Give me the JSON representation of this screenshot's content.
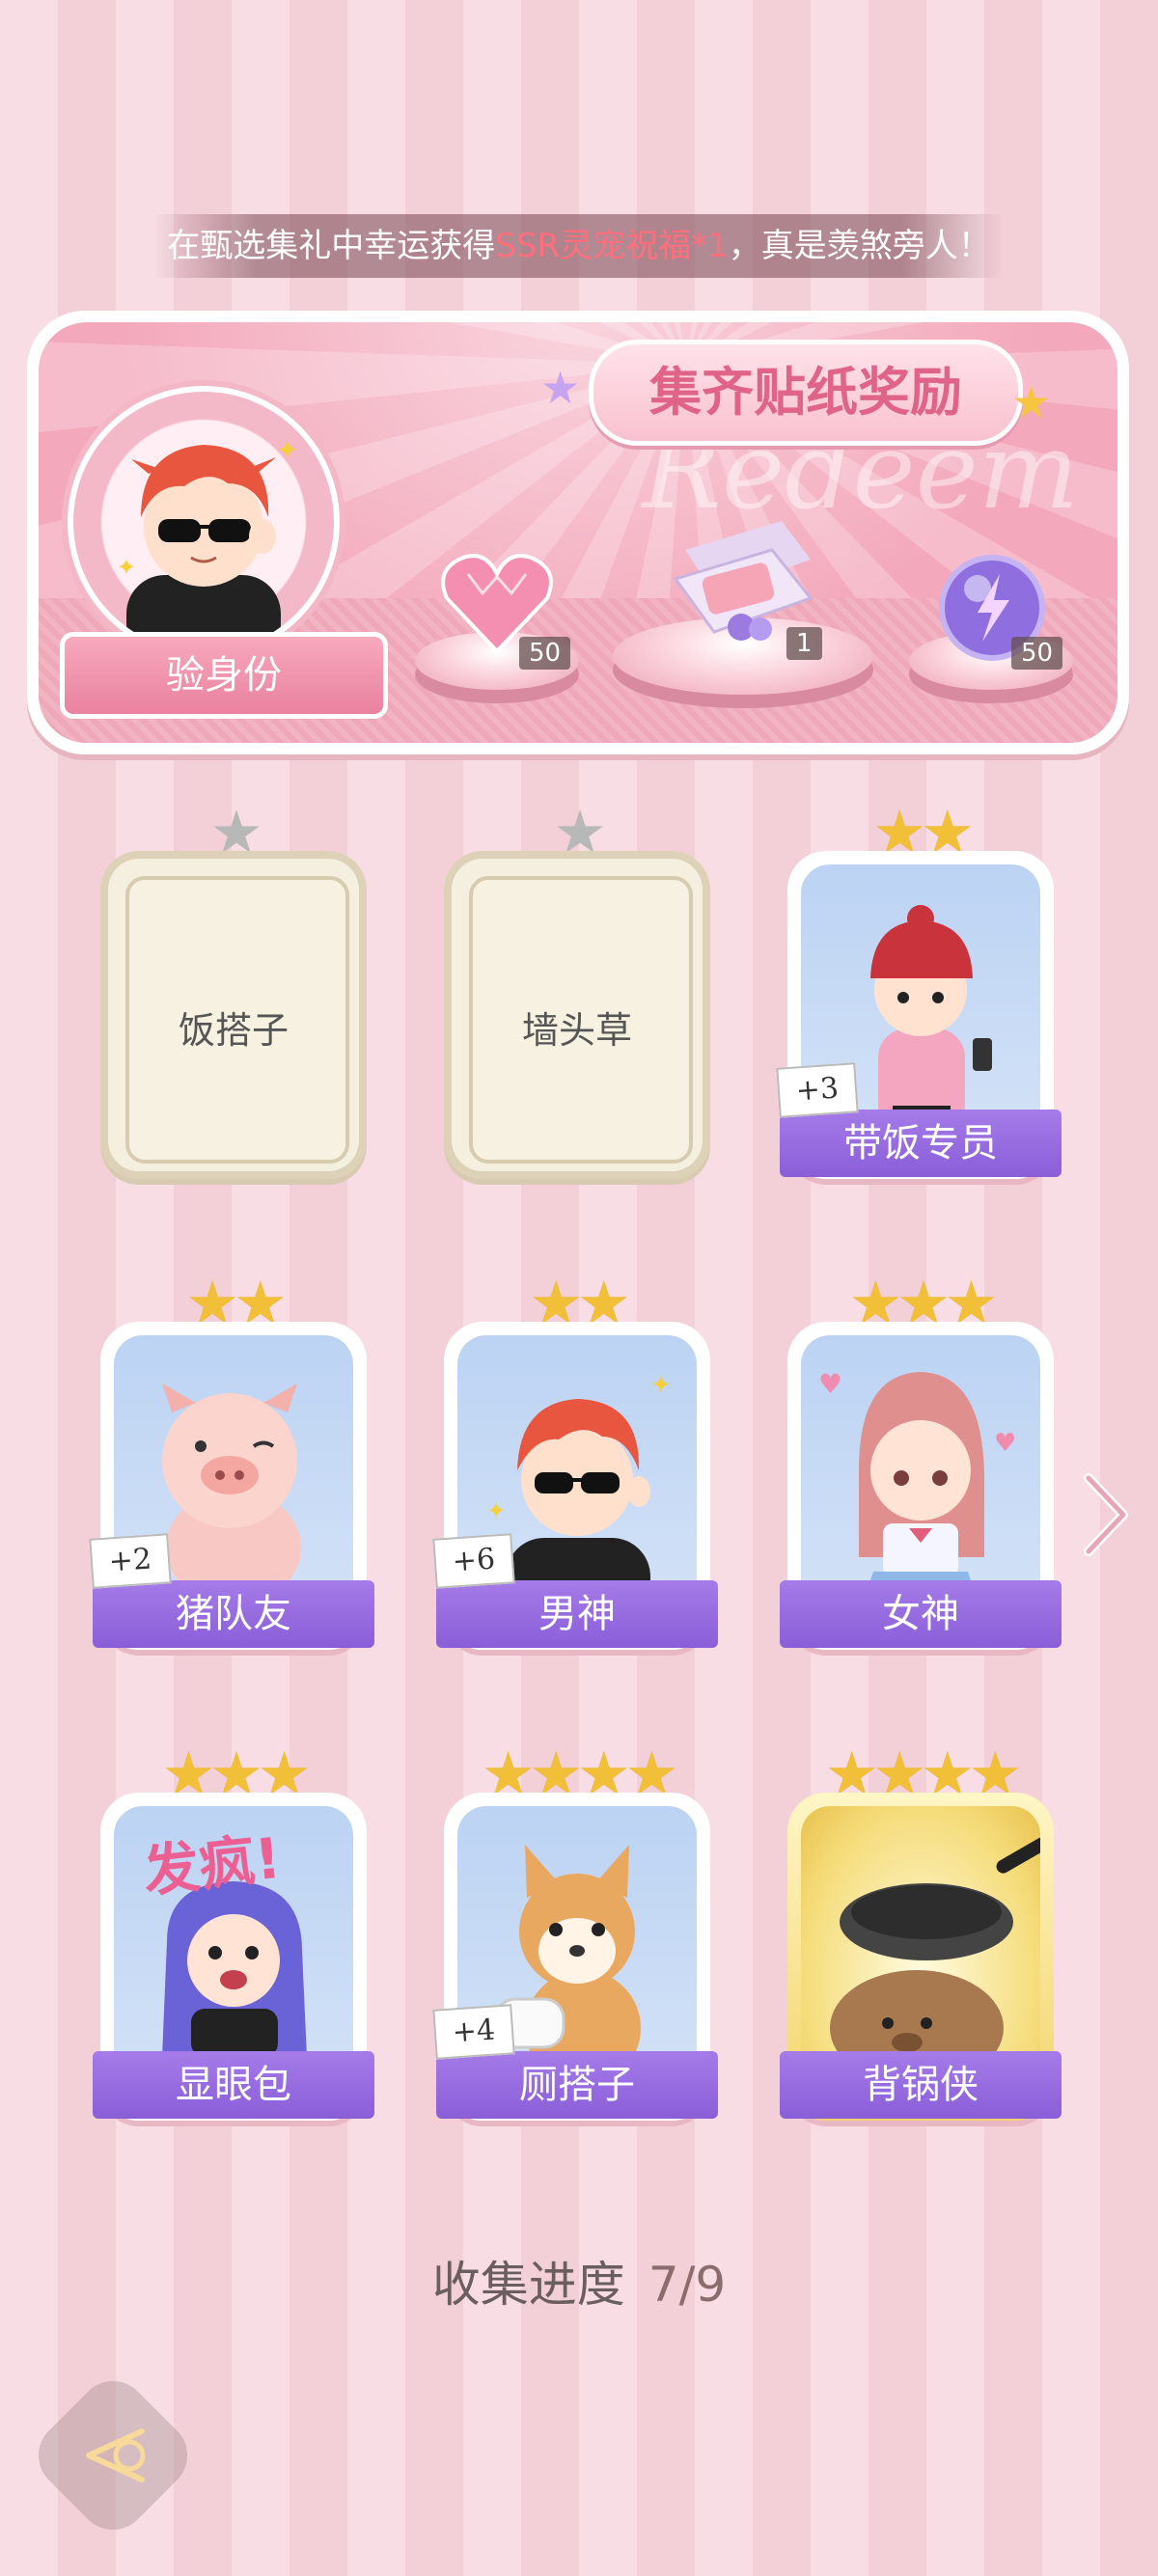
{
  "ticker": {
    "prefix": "在甄选集礼中幸运获得",
    "highlight": "SSR灵宠祝福*1",
    "suffix": "，真是羡煞旁人！"
  },
  "reward_panel": {
    "title": "集齐贴纸奖励",
    "watermark": "Redeem",
    "identity_button": "验身份",
    "rewards": [
      {
        "icon": "pink-heart-gem-icon",
        "quantity": "50"
      },
      {
        "icon": "gift-box-icon",
        "quantity": "1"
      },
      {
        "icon": "lightning-orb-icon",
        "quantity": "50"
      }
    ]
  },
  "cards": [
    {
      "name": "饭搭子",
      "stars": "★",
      "collected": false
    },
    {
      "name": "墙头草",
      "stars": "★",
      "collected": false
    },
    {
      "name": "带饭专员",
      "stars": "★★",
      "collected": true,
      "extra": "+3"
    },
    {
      "name": "猪队友",
      "stars": "★★",
      "collected": true,
      "extra": "+2"
    },
    {
      "name": "男神",
      "stars": "★★",
      "collected": true,
      "extra": "+6"
    },
    {
      "name": "女神",
      "stars": "★★★",
      "collected": true
    },
    {
      "name": "显眼包",
      "stars": "★★★",
      "collected": true,
      "art_text": "发疯!"
    },
    {
      "name": "厕搭子",
      "stars": "★★★★",
      "collected": true,
      "extra": "+4"
    },
    {
      "name": "背锅侠",
      "stars": "★★★★",
      "collected": true
    }
  ],
  "progress": {
    "label": "收集进度",
    "value": "7/9"
  },
  "colors": {
    "accent_purple": "#8a5ed8",
    "star_gold": "#f2c038",
    "pink_title": "#e06488"
  }
}
